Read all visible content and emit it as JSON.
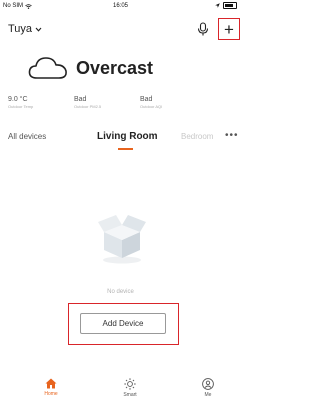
{
  "status_bar": {
    "carrier": "No SIM",
    "time": "16:05"
  },
  "header": {
    "home_name": "Tuya",
    "add_symbol": "+"
  },
  "weather": {
    "condition": "Overcast",
    "metrics": [
      {
        "value": "9.0 °C",
        "label": "Outdoor Temp"
      },
      {
        "value": "Bad",
        "label": "Outdoor PM2.5"
      },
      {
        "value": "Bad",
        "label": "Outdoor AQI"
      }
    ]
  },
  "rooms": {
    "tabs": [
      "All devices",
      "Living Room",
      "Bedroom"
    ],
    "active_tab": "Living Room",
    "more": "•••"
  },
  "empty_state": {
    "message": "No device",
    "button_label": "Add Device"
  },
  "tabbar": {
    "items": [
      {
        "label": "Home",
        "icon": "home-icon",
        "active": true
      },
      {
        "label": "Smart",
        "icon": "sun-icon",
        "active": false
      },
      {
        "label": "Me",
        "icon": "profile-icon",
        "active": false
      }
    ]
  },
  "colors": {
    "accent": "#e8641e",
    "highlight": "#d9252a"
  }
}
